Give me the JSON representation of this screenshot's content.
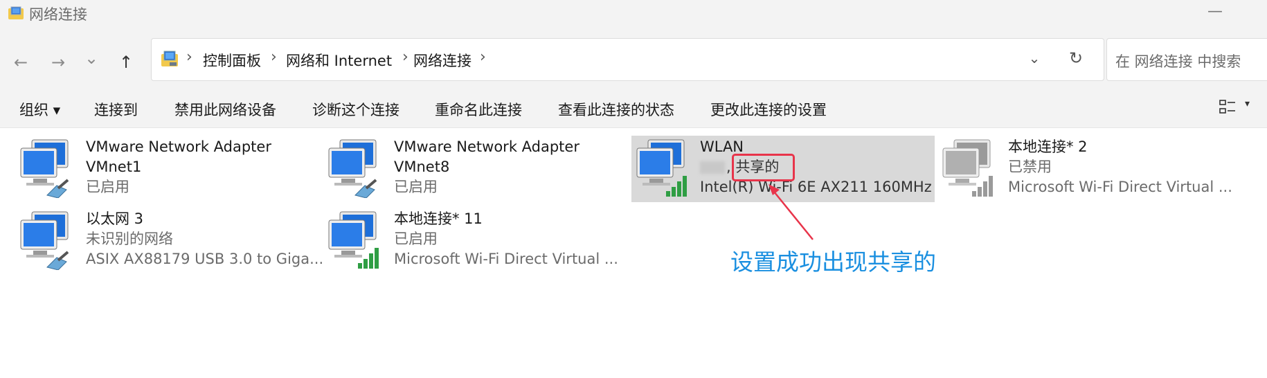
{
  "window": {
    "title": "网络连接",
    "minimize_glyph": "—"
  },
  "nav": {
    "back_glyph": "←",
    "forward_glyph": "→",
    "recent_glyph": "⌄",
    "up_glyph": "↑"
  },
  "address": {
    "sep": "›",
    "crumbs": [
      "控制面板",
      "网络和 Internet",
      "网络连接"
    ],
    "dropdown_glyph": "⌄",
    "refresh_glyph": "↻"
  },
  "search": {
    "placeholder": "在 网络连接 中搜索"
  },
  "commands": {
    "organize": "组织 ▾",
    "connect": "连接到",
    "disable": "禁用此网络设备",
    "diagnose": "诊断这个连接",
    "rename": "重命名此连接",
    "status": "查看此连接的状态",
    "settings": "更改此连接的设置",
    "view_dd": "▾"
  },
  "connections": [
    {
      "name": "VMware Network Adapter",
      "name2": "VMnet1",
      "status": "已启用",
      "icon": "ethernet-adapter-icon"
    },
    {
      "name": "VMware Network Adapter",
      "name2": "VMnet8",
      "status": "已启用",
      "icon": "ethernet-adapter-icon"
    },
    {
      "name": "WLAN",
      "status_suffix": ", 共享的",
      "device": "Intel(R) Wi-Fi 6E AX211 160MHz",
      "icon": "wifi-adapter-icon",
      "selected": true
    },
    {
      "name": "本地连接* 2",
      "status": "已禁用",
      "device": "Microsoft Wi-Fi Direct Virtual ...",
      "icon": "wifi-adapter-icon"
    },
    {
      "name": "以太网 3",
      "status": "未识别的网络",
      "device": "ASIX AX88179 USB 3.0 to Giga...",
      "icon": "ethernet-adapter-icon"
    },
    {
      "name": "本地连接* 11",
      "status": "已启用",
      "device": "Microsoft Wi-Fi Direct Virtual ...",
      "icon": "wifi-adapter-icon"
    }
  ],
  "annotation": {
    "text": "设置成功出现共享的",
    "color": "#1a8fe0",
    "box_color": "#e8344a"
  }
}
